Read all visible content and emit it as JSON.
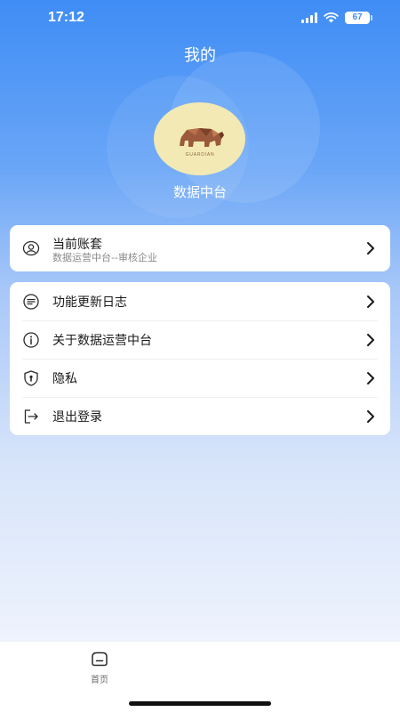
{
  "status_bar": {
    "time": "17:12",
    "battery": "67"
  },
  "header": {
    "title": "我的"
  },
  "profile": {
    "avatar_logo_text": "GUARDIAN",
    "name": "数据中台"
  },
  "account": {
    "title": "当前账套",
    "subtitle": "数据运营中台--审核企业",
    "icon": "user-circle-icon"
  },
  "menu": {
    "items": [
      {
        "label": "功能更新日志",
        "icon": "list-lines-icon"
      },
      {
        "label": "关于数据运营中台",
        "icon": "info-icon"
      },
      {
        "label": "隐私",
        "icon": "shield-icon"
      },
      {
        "label": "退出登录",
        "icon": "logout-icon"
      }
    ]
  },
  "tab_bar": {
    "tabs": [
      {
        "label": "首页",
        "icon": "home-icon"
      }
    ]
  },
  "colors": {
    "primary_blue": "#3f8df5",
    "card_bg": "#ffffff",
    "text_primary": "#1a1a1a",
    "text_secondary": "#8a8a8a"
  }
}
